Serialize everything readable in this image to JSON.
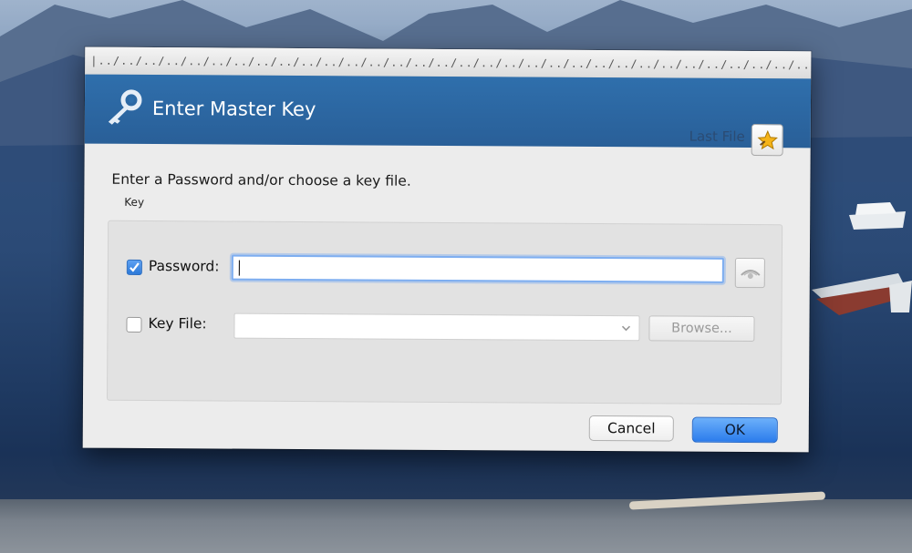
{
  "dialog": {
    "title_strip": "|../../../../../../../../../../../../../../../../../../../../../../../../../../../../../../../../../../../../../../../../../../../../../../../../../..|",
    "title": "Enter Master Key",
    "last_file_label": "Last File",
    "instruction": "Enter a Password and/or choose a key file.",
    "group_label": "Key",
    "password": {
      "label": "Password:",
      "checked": true,
      "value": ""
    },
    "key_file": {
      "label": "Key File:",
      "checked": false,
      "selected": ""
    },
    "browse_label": "Browse...",
    "cancel_label": "Cancel",
    "ok_label": "OK"
  },
  "icons": {
    "banner": "key-icon",
    "last_file": "star-icon",
    "reveal": "eye-icon",
    "dropdown": "chevron-down-icon"
  },
  "colors": {
    "banner": "#2f6fac",
    "ok_button": "#2b7cec",
    "checkbox_checked": "#2a78d9",
    "focus_ring": "#7eaef0"
  }
}
